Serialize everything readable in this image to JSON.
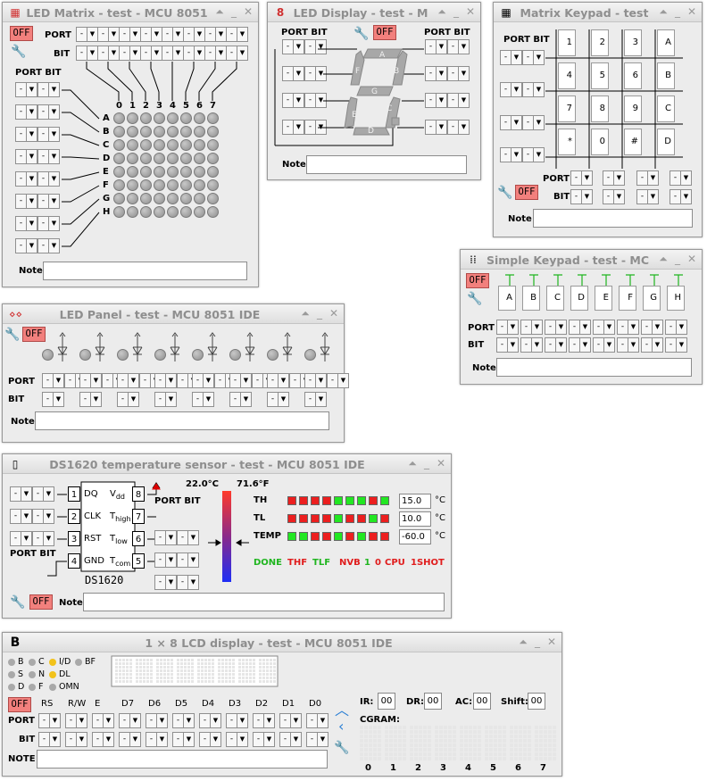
{
  "common": {
    "dash": "-",
    "arrow": "▼",
    "off": "OFF",
    "port": "PORT",
    "bit": "BIT",
    "note": "Note",
    "port_bit": "PORT BIT",
    "minimize": "⏶",
    "maximize": "_",
    "close": "✕"
  },
  "led_matrix": {
    "title": "LED Matrix - test - MCU 8051",
    "columns": [
      "0",
      "1",
      "2",
      "3",
      "4",
      "5",
      "6",
      "7"
    ],
    "rows": [
      "A",
      "B",
      "C",
      "D",
      "E",
      "F",
      "G",
      "H"
    ]
  },
  "led_display": {
    "title": "LED Display - test - M",
    "segments": [
      "A",
      "B",
      "C",
      "D",
      "E",
      "F",
      "G"
    ]
  },
  "matrix_keypad": {
    "title": "Matrix Keypad - test",
    "keys": [
      "1",
      "2",
      "3",
      "A",
      "4",
      "5",
      "6",
      "B",
      "7",
      "8",
      "9",
      "C",
      "*",
      "0",
      "#",
      "D"
    ]
  },
  "simple_keypad": {
    "title": "Simple Keypad - test - MC",
    "keys": [
      "A",
      "B",
      "C",
      "D",
      "E",
      "F",
      "G",
      "H"
    ]
  },
  "led_panel": {
    "title": "LED Panel - test - MCU 8051 IDE"
  },
  "ds1620": {
    "title": "DS1620 temperature sensor - test - MCU 8051 IDE",
    "pins_left": [
      {
        "num": "1",
        "name": "DQ"
      },
      {
        "num": "2",
        "name": "CLK"
      },
      {
        "num": "3",
        "name": "RST"
      },
      {
        "num": "4",
        "name": "GND"
      }
    ],
    "pins_right": [
      {
        "num": "8",
        "name": "V",
        "sub": "dd"
      },
      {
        "num": "7",
        "name": "T",
        "sub": "high"
      },
      {
        "num": "6",
        "name": "T",
        "sub": "low"
      },
      {
        "num": "5",
        "name": "T",
        "sub": "com"
      }
    ],
    "chip_name": "DS1620",
    "temp_c": "22.0°C",
    "temp_f": "71.6°F",
    "rows": [
      {
        "label": "TH",
        "value": "15.0",
        "unit": "°C",
        "bits": [
          "r",
          "r",
          "r",
          "r",
          "g",
          "g",
          "g",
          "r",
          "g"
        ]
      },
      {
        "label": "TL",
        "value": "10.0",
        "unit": "°C",
        "bits": [
          "r",
          "r",
          "r",
          "r",
          "g",
          "r",
          "r",
          "g",
          "r"
        ]
      },
      {
        "label": "TEMP",
        "value": "-60.0",
        "unit": "°C",
        "bits": [
          "g",
          "g",
          "r",
          "r",
          "g",
          "r",
          "g",
          "r",
          "r"
        ]
      }
    ],
    "flags": [
      {
        "text": "DONE",
        "color": "#1fb51f"
      },
      {
        "text": "THF",
        "color": "#e01c1c"
      },
      {
        "text": "TLF",
        "color": "#1fb51f"
      },
      {
        "text": "NVB",
        "color": "#e01c1c"
      },
      {
        "text": "1",
        "color": "#1fb51f"
      },
      {
        "text": "0",
        "color": "#e01c1c"
      },
      {
        "text": "CPU",
        "color": "#e01c1c"
      },
      {
        "text": "1SHOT",
        "color": "#e01c1c"
      }
    ],
    "bit_colors": {
      "r": "#ec1f1f",
      "g": "#22e722"
    }
  },
  "lcd": {
    "title": "1 × 8 LCD display - test - MCU 8051 IDE",
    "flags": [
      {
        "text": "B",
        "on": false
      },
      {
        "text": "C",
        "on": false
      },
      {
        "text": "I/D",
        "on": true
      },
      {
        "text": "BF",
        "on": false
      },
      {
        "text": "S",
        "on": false
      },
      {
        "text": "N",
        "on": false
      },
      {
        "text": "DL",
        "on": true
      },
      {
        "text": "D",
        "on": false
      },
      {
        "text": "F",
        "on": false
      },
      {
        "text": "OMN",
        "on": false
      }
    ],
    "columns": [
      "RS",
      "R/W",
      "E",
      "D7",
      "D6",
      "D5",
      "D4",
      "D3",
      "D2",
      "D1",
      "D0"
    ],
    "note_label": "NOTE",
    "regs": [
      {
        "label": "IR:",
        "value": "00"
      },
      {
        "label": "DR:",
        "value": "00"
      },
      {
        "label": "AC:",
        "value": "00"
      },
      {
        "label": "Shift:",
        "value": "00"
      }
    ],
    "cgram_label": "CGRAM:",
    "cgram_index": [
      "0",
      "1",
      "2",
      "3",
      "4",
      "5",
      "6",
      "7"
    ]
  }
}
